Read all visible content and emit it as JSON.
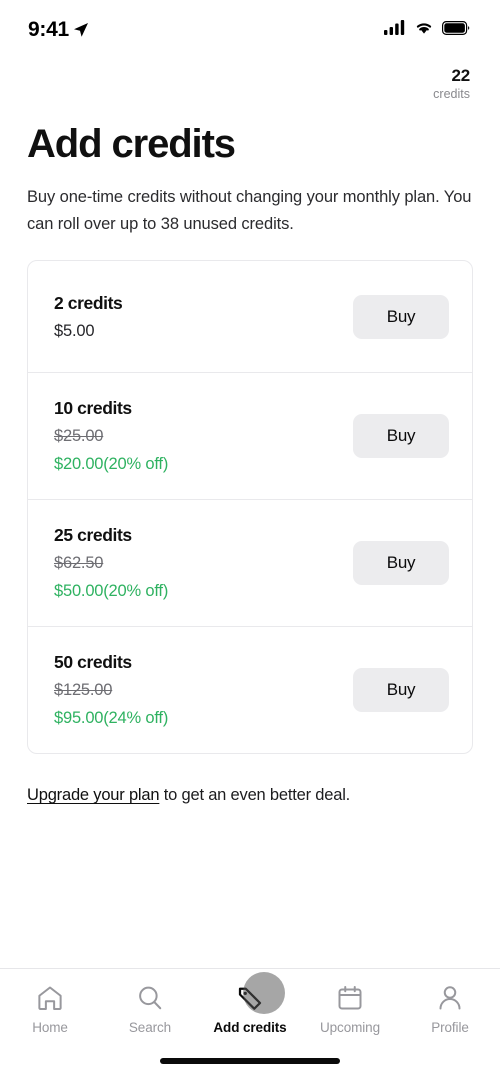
{
  "status_bar": {
    "time": "9:41",
    "location_icon": "location-arrow-icon",
    "signal_icon": "cellular-signal-icon",
    "wifi_icon": "wifi-icon",
    "battery_icon": "battery-full-icon"
  },
  "header": {
    "credits_count": "22",
    "credits_label": "credits"
  },
  "page": {
    "title": "Add credits",
    "subtitle": "Buy one-time credits without changing your monthly plan. You can roll over up to 38 unused credits."
  },
  "offers": [
    {
      "name": "2 credits",
      "base_price": "$5.00",
      "struck": false,
      "discount_price": "",
      "buy_label": "Buy"
    },
    {
      "name": "10 credits",
      "base_price": "$25.00",
      "struck": true,
      "discount_price": "$20.00(20% off)",
      "buy_label": "Buy"
    },
    {
      "name": "25 credits",
      "base_price": "$62.50",
      "struck": true,
      "discount_price": "$50.00(20% off)",
      "buy_label": "Buy"
    },
    {
      "name": "50 credits",
      "base_price": "$125.00",
      "struck": true,
      "discount_price": "$95.00(24% off)",
      "buy_label": "Buy"
    }
  ],
  "upgrade_note": {
    "link_text": "Upgrade your plan",
    "rest_text": " to get an even better deal."
  },
  "tabbar": {
    "items": [
      {
        "label": "Home",
        "icon": "home-icon",
        "active": false
      },
      {
        "label": "Search",
        "icon": "search-icon",
        "active": false
      },
      {
        "label": "Add credits",
        "icon": "tag-icon",
        "active": true
      },
      {
        "label": "Upcoming",
        "icon": "calendar-icon",
        "active": false
      },
      {
        "label": "Profile",
        "icon": "person-icon",
        "active": false
      }
    ]
  },
  "colors": {
    "accent_green": "#2fb261",
    "button_grey": "#ececee",
    "muted_text": "#98989d",
    "border": "#e9e9ec"
  }
}
